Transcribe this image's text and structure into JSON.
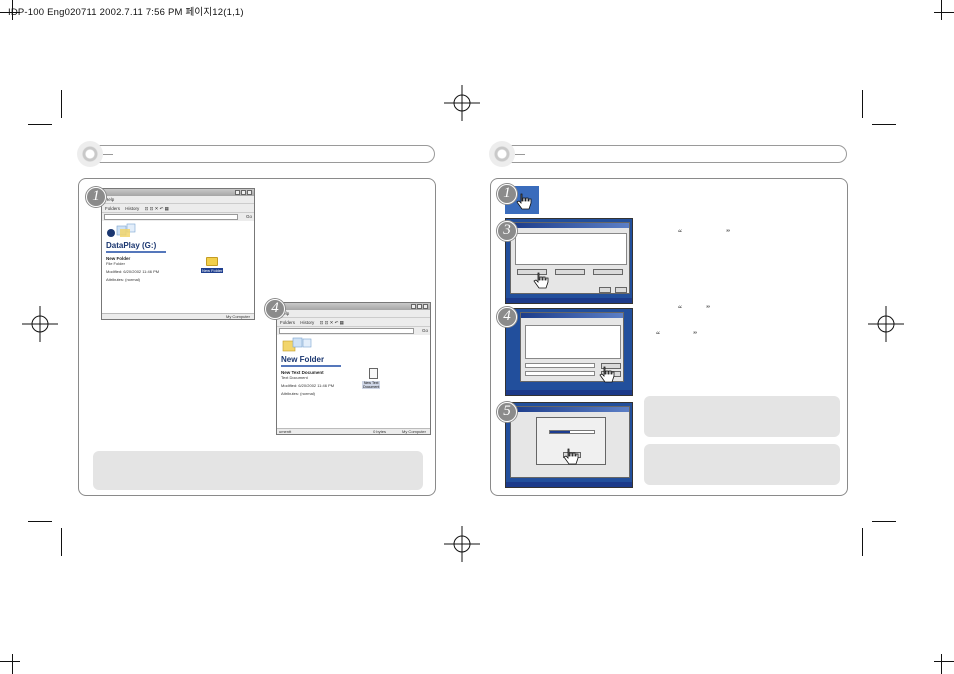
{
  "slug": "IDP-100 Eng020711  2002.7.11 7:56 PM 페이지12(1,1)",
  "left_page": {
    "steps": {
      "s1": "1",
      "s2": "4"
    },
    "window1": {
      "menu": "Help",
      "toolbar": [
        "Folders",
        "History"
      ],
      "go_label": "Go",
      "drive_title": "DataPlay (G:)",
      "item_name": "New Folder",
      "item_type": "File Folder",
      "modified": "Modified: 6/20/2002 11:46 PM",
      "attributes": "Attributes: (normal)",
      "folder_label": "New Folder",
      "status_right": "My Computer"
    },
    "window2": {
      "menu": "Help",
      "toolbar": [
        "Folders",
        "History"
      ],
      "go_label": "Go",
      "folder_title": "New Folder",
      "item_name": "New Text Document",
      "item_type": "Text Document",
      "modified": "Modified: 6/20/2002 11:46 PM",
      "attributes": "Attributes: (normal)",
      "doc_label_1": "New Text",
      "doc_label_2": "Document",
      "status_left": "umentt",
      "status_mid": "0 bytes",
      "status_right": "My Computer"
    }
  },
  "right_page": {
    "steps": {
      "s1": "1",
      "s2": "3",
      "s3": "4",
      "s4": "5"
    },
    "quotes": {
      "q1_open": "“",
      "q1_close": "”",
      "q2_open": "“",
      "q2_close": "”",
      "q3_open": "“",
      "q3_close": "”"
    },
    "colors": {
      "desktop_blue": "#224f9c",
      "note_gray": "#e4e4e4"
    }
  }
}
